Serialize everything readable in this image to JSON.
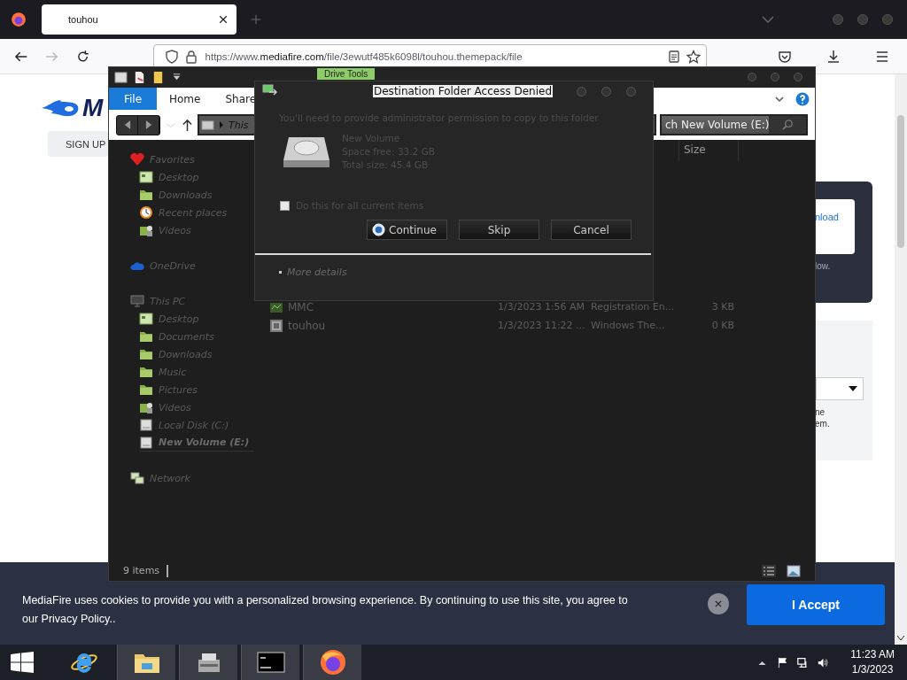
{
  "browser": {
    "tab": {
      "title": "touhou",
      "selected": true
    },
    "url": "https://www.**mediafire.com**/file/3ewutf485k6098l/touhou.themepack/file"
  },
  "page": {
    "logo_text": "M",
    "sign_up": "SIGN UP",
    "panel_link": "nload",
    "panel_note": "low.",
    "form_lines": [
      "ne",
      "em."
    ]
  },
  "cookie_banner": {
    "text": "MediaFire uses cookies to provide you with a personalized browsing experience. By continuing to use this site, you agree to our Privacy Policy..",
    "accept": "I Accept"
  },
  "explorer": {
    "context_tab": "Drive Tools",
    "ribbon_tabs": [
      {
        "label": "File",
        "selected": true
      },
      {
        "label": "Home",
        "selected": false
      },
      {
        "label": "Share",
        "selected": false
      }
    ],
    "address": "This",
    "search": "ch New Volume (E:)",
    "columns": [
      "Size"
    ],
    "nav": [
      {
        "label": "Favorites",
        "kind": "heart",
        "selected": false,
        "children": [
          {
            "label": "Desktop",
            "kind": "desktop",
            "selected": false
          },
          {
            "label": "Downloads",
            "kind": "folder",
            "selected": false
          },
          {
            "label": "Recent places",
            "kind": "clock",
            "selected": false
          },
          {
            "label": "Videos",
            "kind": "media",
            "selected": false
          }
        ]
      },
      {
        "label": "OneDrive",
        "kind": "cloud",
        "selected": false
      },
      {
        "label": "This PC",
        "kind": "monitor",
        "selected": false,
        "children": [
          {
            "label": "Desktop",
            "kind": "desktop",
            "selected": false
          },
          {
            "label": "Documents",
            "kind": "folder",
            "selected": false
          },
          {
            "label": "Downloads",
            "kind": "folder",
            "selected": false
          },
          {
            "label": "Music",
            "kind": "folder",
            "selected": false
          },
          {
            "label": "Pictures",
            "kind": "folder",
            "selected": false
          },
          {
            "label": "Videos",
            "kind": "media",
            "selected": false
          },
          {
            "label": "Local Disk (C:)",
            "kind": "drive",
            "selected": false
          },
          {
            "label": "New Volume (E:)",
            "kind": "drive",
            "selected": true
          }
        ]
      },
      {
        "label": "Network",
        "kind": "network",
        "selected": false
      }
    ],
    "files": [
      {
        "name": "MMC",
        "date": "1/3/2023 1:56 AM",
        "type": "Registration En...",
        "size": "3 KB",
        "kind": "reg"
      },
      {
        "name": "touhou",
        "date": "1/3/2023 11:22 ...",
        "type": "Windows The...",
        "size": "0 KB",
        "kind": "theme"
      }
    ],
    "status": "9 items"
  },
  "dialog": {
    "title": "Destination Folder Access Denied",
    "message": "You'll need to provide administrator permission to copy to this folder",
    "drive": [
      "New Volume",
      "Space free: 33.2 GB",
      "Total size: 45.4 GB"
    ],
    "checkbox": {
      "label": "Do this for all current items",
      "checked": false
    },
    "buttons": [
      {
        "label": "Continue",
        "kind": "shield"
      },
      {
        "label": "Skip",
        "kind": "plain"
      },
      {
        "label": "Cancel",
        "kind": "plain"
      }
    ],
    "details": "More details"
  },
  "taskbar": {
    "apps": [
      {
        "kind": "ie",
        "running": false
      },
      {
        "kind": "explorer",
        "running": true
      },
      {
        "kind": "tool",
        "running": true
      },
      {
        "kind": "cmd",
        "running": true
      },
      {
        "kind": "firefox",
        "running": true
      }
    ],
    "time": "11:23 AM",
    "date": "1/3/2023"
  }
}
